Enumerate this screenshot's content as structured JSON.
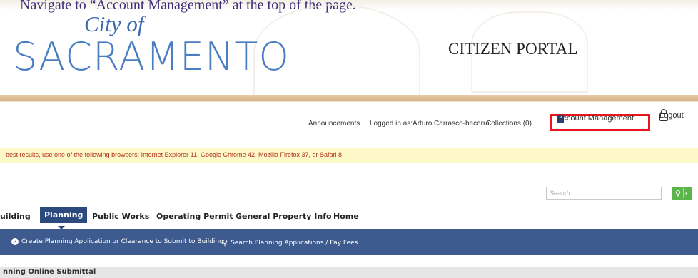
{
  "instruction": "Navigate to “Account Management” at the top of the page.",
  "header": {
    "logo_city": "City of",
    "logo_name": "SACRAMENTO",
    "portal_title": "CITIZEN PORTAL"
  },
  "top_links": {
    "announcements": "Announcements",
    "logged_in": "Logged in as:Arturo Carrasco-becerra",
    "collections": "Collections (0)",
    "account_management": "Account Management",
    "logout": "Logout",
    "highlight_color": "#e8141e"
  },
  "banner": {
    "text": "best results, use one of the following browsers: Internet Explorer 11, Google Chrome 42, Mozilla Firefox 37, or Safari 8."
  },
  "search": {
    "placeholder": "Search..."
  },
  "nav": {
    "tabs": [
      {
        "label": "uilding"
      },
      {
        "label": "Planning",
        "active": true
      },
      {
        "label": "Public Works"
      },
      {
        "label": "Operating Permit"
      },
      {
        "label": "General Property Info"
      },
      {
        "label": "Home"
      }
    ]
  },
  "subnav": {
    "create": "Create Planning Application or Clearance to Submit to Building",
    "search": "Search Planning Applications / Pay Fees"
  },
  "section": {
    "title": "nning Online Submittal"
  },
  "colors": {
    "nav_active": "#2c4a7d",
    "subbar": "#3d5b8f",
    "search_button": "#5bb54a",
    "banner_bg": "#fdf8c8",
    "banner_text": "#b3331a"
  }
}
